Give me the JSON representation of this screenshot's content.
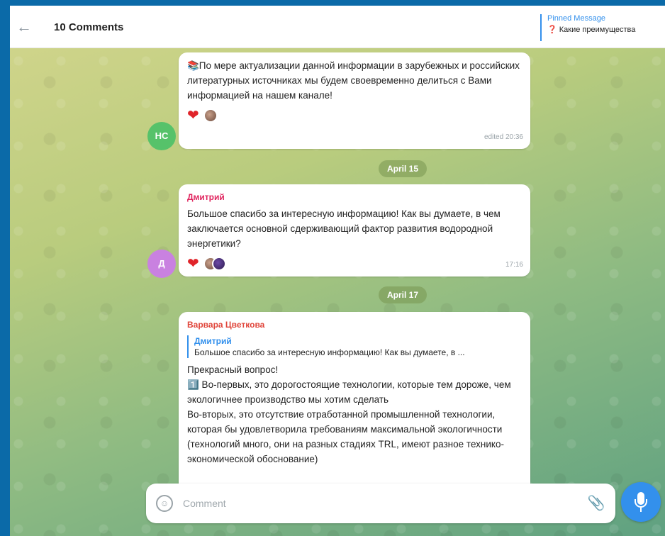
{
  "header": {
    "back_icon": "arrow-left-icon",
    "title": "10 Comments",
    "pinned": {
      "title": "Pinned Message",
      "marker": "❓",
      "text": "Какие преимущества"
    }
  },
  "messages": [
    {
      "avatar_initials": "НС",
      "avatar_color": "#56c26a",
      "text": "📚По мере актуализации данной информации в зарубежных и российских литературных источниках мы будем своевременно делиться с Вами информацией на нашем канале!",
      "time": "edited 20:36",
      "reaction": "❤"
    },
    {
      "date": "April 15"
    },
    {
      "sender": "Дмитрий",
      "sender_color": "#e0245e",
      "avatar_initials": "Д",
      "avatar_color": "#c981e0",
      "text": "Большое спасибо за интересную информацию! Как вы думаете, в чем заключается основной сдерживающий фактор развития водородной энергетики?",
      "time": "17:16",
      "reaction": "❤"
    },
    {
      "date": "April 17"
    },
    {
      "sender": "Варвара Цветкова",
      "sender_color": "#e0453a",
      "reply": {
        "name": "Дмитрий",
        "text": "Большое спасибо за интересную информацию! Как вы думаете, в ..."
      },
      "text_lines": [
        "Прекрасный вопрос!",
        "1️⃣ Во-первых, это дорогостоящие технологии, которые тем дороже, чем экологичнее производство мы хотим сделать",
        "Во-вторых, это отсутствие отработанной промышленной технологии, которая бы удовлетворила требованиям максимальной экологичности (технологий много, они на разных стадиях TRL, имеют разное технико-экономической обоснование)"
      ]
    }
  ],
  "composer": {
    "placeholder": "Comment",
    "emoji_icon": "smile-icon",
    "attach_icon": "paperclip-icon",
    "mic_icon": "microphone-icon"
  },
  "colors": {
    "accent": "#3390ec",
    "heart": "#e0242a"
  }
}
